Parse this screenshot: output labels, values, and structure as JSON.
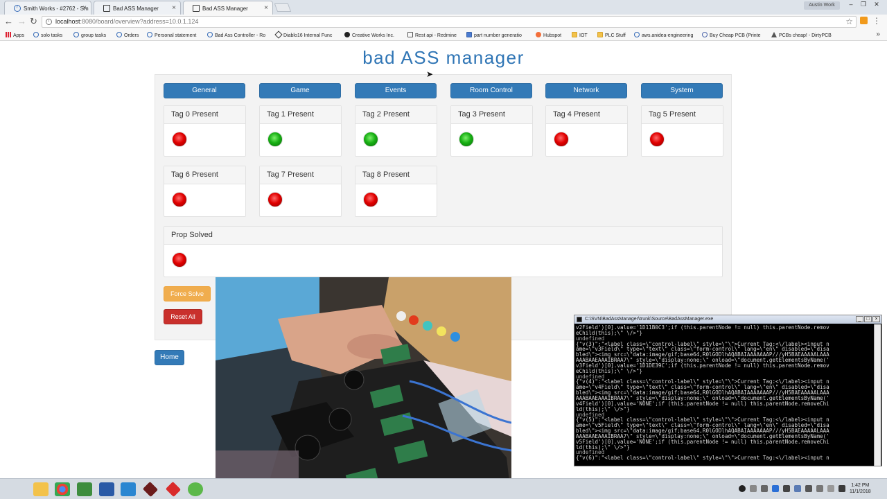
{
  "browser": {
    "tabs": [
      {
        "title": "Smith Works - #2762 - Sm",
        "active": false
      },
      {
        "title": "Bad ASS Manager",
        "active": false
      },
      {
        "title": "Bad ASS Manager",
        "active": true
      }
    ],
    "user": "Austin Work",
    "url_host": "localhost",
    "url_rest": ":8080/board/overview?address=10.0.1.124",
    "bookmarks": [
      {
        "label": "Apps",
        "icon": "apps-grid-icon"
      },
      {
        "label": "solo tasks",
        "icon": "globe-icon"
      },
      {
        "label": "group tasks",
        "icon": "globe-icon"
      },
      {
        "label": "Orders",
        "icon": "globe-icon"
      },
      {
        "label": "Personal statement",
        "icon": "globe-icon"
      },
      {
        "label": "Bad Ass Controller - Ro",
        "icon": "globe-icon"
      },
      {
        "label": "Diablo16 Internal Func",
        "icon": "diamond-icon"
      },
      {
        "label": "Creative Works Inc.",
        "icon": "github-icon"
      },
      {
        "label": "Rest api - Redmine",
        "icon": "page-icon"
      },
      {
        "label": "part number generatio",
        "icon": "doc-icon"
      },
      {
        "label": "Hubspot",
        "icon": "hubspot-icon"
      },
      {
        "label": "IOT",
        "icon": "folder-icon"
      },
      {
        "label": "PLC Stuff",
        "icon": "folder-icon"
      },
      {
        "label": "aws.anidea-engineering",
        "icon": "globe-icon"
      },
      {
        "label": "Buy Cheap PCB (Printe",
        "icon": "gear-icon"
      },
      {
        "label": "PCBs cheap! - DirtyPCB",
        "icon": "warning-icon"
      }
    ]
  },
  "page": {
    "title": "bad ASS manager",
    "nav": [
      "General",
      "Game",
      "Events",
      "Room Control",
      "Network",
      "System"
    ],
    "tags": [
      {
        "label": "Tag 0 Present",
        "status": "red"
      },
      {
        "label": "Tag 1 Present",
        "status": "green"
      },
      {
        "label": "Tag 2 Present",
        "status": "green"
      },
      {
        "label": "Tag 3 Present",
        "status": "green"
      },
      {
        "label": "Tag 4 Present",
        "status": "red"
      },
      {
        "label": "Tag 5 Present",
        "status": "red"
      },
      {
        "label": "Tag 6 Present",
        "status": "red"
      },
      {
        "label": "Tag 7 Present",
        "status": "red"
      },
      {
        "label": "Tag 8 Present",
        "status": "red"
      }
    ],
    "prop": {
      "label": "Prop Solved",
      "status": "red"
    },
    "force_solve": "Force Solve",
    "reset_all": "Reset All",
    "home": "Home"
  },
  "console": {
    "title": "C:\\SVN\\BadAssManager\\trunk\\Source\\BadAssManager.exe",
    "lines": [
      "v2Field')[0].value='1D11B0C3';if (this.parentNode != null) this.parentNode.remov",
      "eChild(this);\\\" \\/>\"}",
      "undefined",
      "{\"v(3)\":\"<label class=\\\"control-label\\\" style=\\\"\\\">Current Tag:<\\/label><input n",
      "ame=\\\"v3Field\\\" type=\\\"text\\\" class=\\\"form-control\\\" lang=\\\"en\\\" disabled=\\\"disa",
      "bled\\\"><img src=\\\"data:image/gif;base64,R0lGODlhAQABAIAAAAAAAP///yH5BAEAAAAALAAA",
      "AAABAAEAAAIBRAA7\\\" style=\\\"display:none;\\\" onload=\\\"document.getElementsByName('",
      "v3Field')[0].value='1D1DE39C';if (this.parentNode != null) this.parentNode.remov",
      "eChild(this);\\\" \\/>\"}",
      "undefined",
      "{\"v(4)\":\"<label class=\\\"control-label\\\" style=\\\"\\\">Current Tag:<\\/label><input n",
      "ame=\\\"v4Field\\\" type=\\\"text\\\" class=\\\"form-control\\\" lang=\\\"en\\\" disabled=\\\"disa",
      "bled\\\"><img src=\\\"data:image/gif;base64,R0lGODlhAQABAIAAAAAAAP///yH5BAEAAAAALAAA",
      "AAABAAEAAAIBRAA7\\\" style=\\\"display:none;\\\" onload=\\\"document.getElementsByName('",
      "v4Field')[0].value='NONE';if (this.parentNode != null) this.parentNode.removeChi",
      "ld(this);\\\" \\/>\"}",
      "undefined",
      "{\"v(5)\":\"<label class=\\\"control-label\\\" style=\\\"\\\">Current Tag:<\\/label><input n",
      "ame=\\\"v5Field\\\" type=\\\"text\\\" class=\\\"form-control\\\" lang=\\\"en\\\" disabled=\\\"disa",
      "bled\\\"><img src=\\\"data:image/gif;base64,R0lGODlhAQABAIAAAAAAAP///yH5BAEAAAAALAAA",
      "AAABAAEAAAIBRAA7\\\" style=\\\"display:none;\\\" onload=\\\"document.getElementsByName('",
      "v5Field')[0].value='NONE';if (this.parentNode != null) this.parentNode.removeChi",
      "ld(this);\\\" \\/>\"}",
      "undefined",
      "{\"v(6)\":\"<label class=\\\"control-label\\\" style=\\\"\\\">Current Tag:<\\/label><input n"
    ]
  },
  "taskbar": {
    "time": "1:42 PM",
    "date": "11/1/2018"
  }
}
